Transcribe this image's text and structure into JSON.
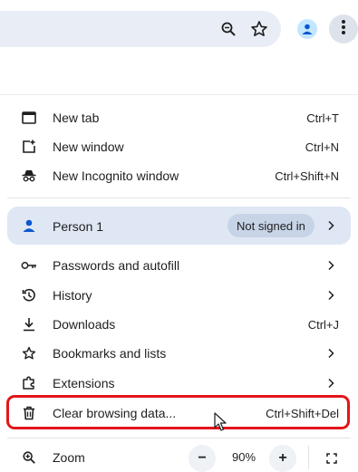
{
  "toolbar": {
    "icons": [
      "zoom-icon",
      "bookmark-star-icon",
      "profile-icon",
      "more-options-icon"
    ]
  },
  "menu": {
    "new_tab": {
      "label": "New tab",
      "shortcut": "Ctrl+T",
      "icon": "new-tab-icon"
    },
    "new_window": {
      "label": "New window",
      "shortcut": "Ctrl+N",
      "icon": "new-window-icon"
    },
    "new_incognito": {
      "label": "New Incognito window",
      "shortcut": "Ctrl+Shift+N",
      "icon": "incognito-icon"
    },
    "profile": {
      "label": "Person 1",
      "status": "Not signed in",
      "icon": "person-icon"
    },
    "passwords": {
      "label": "Passwords and autofill",
      "icon": "key-icon"
    },
    "history": {
      "label": "History",
      "icon": "history-icon"
    },
    "downloads": {
      "label": "Downloads",
      "shortcut": "Ctrl+J",
      "icon": "download-icon"
    },
    "bookmarks": {
      "label": "Bookmarks and lists",
      "icon": "star-icon"
    },
    "extensions": {
      "label": "Extensions",
      "icon": "puzzle-icon"
    },
    "clear_data": {
      "label": "Clear browsing data...",
      "shortcut": "Ctrl+Shift+Del",
      "icon": "trash-icon"
    },
    "zoom": {
      "label": "Zoom",
      "value": "90%",
      "minus": "−",
      "plus": "+",
      "icon": "zoom-icon"
    }
  },
  "colors": {
    "omnibox": "#e9eef6",
    "profile_card": "#dfe7f4",
    "highlight": "#e3151a",
    "accent": "#0b57d0"
  }
}
